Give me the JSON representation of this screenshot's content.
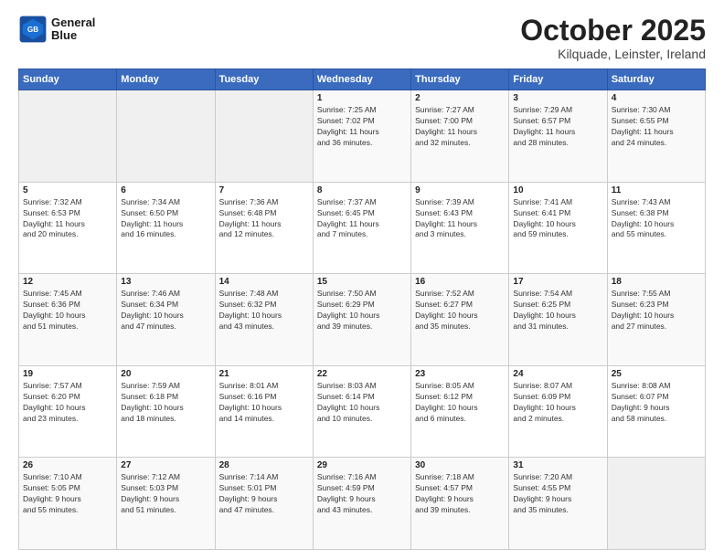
{
  "logo": {
    "line1": "General",
    "line2": "Blue"
  },
  "title": "October 2025",
  "subtitle": "Kilquade, Leinster, Ireland",
  "weekdays": [
    "Sunday",
    "Monday",
    "Tuesday",
    "Wednesday",
    "Thursday",
    "Friday",
    "Saturday"
  ],
  "weeks": [
    [
      {
        "day": "",
        "info": ""
      },
      {
        "day": "",
        "info": ""
      },
      {
        "day": "",
        "info": ""
      },
      {
        "day": "1",
        "info": "Sunrise: 7:25 AM\nSunset: 7:02 PM\nDaylight: 11 hours\nand 36 minutes."
      },
      {
        "day": "2",
        "info": "Sunrise: 7:27 AM\nSunset: 7:00 PM\nDaylight: 11 hours\nand 32 minutes."
      },
      {
        "day": "3",
        "info": "Sunrise: 7:29 AM\nSunset: 6:57 PM\nDaylight: 11 hours\nand 28 minutes."
      },
      {
        "day": "4",
        "info": "Sunrise: 7:30 AM\nSunset: 6:55 PM\nDaylight: 11 hours\nand 24 minutes."
      }
    ],
    [
      {
        "day": "5",
        "info": "Sunrise: 7:32 AM\nSunset: 6:53 PM\nDaylight: 11 hours\nand 20 minutes."
      },
      {
        "day": "6",
        "info": "Sunrise: 7:34 AM\nSunset: 6:50 PM\nDaylight: 11 hours\nand 16 minutes."
      },
      {
        "day": "7",
        "info": "Sunrise: 7:36 AM\nSunset: 6:48 PM\nDaylight: 11 hours\nand 12 minutes."
      },
      {
        "day": "8",
        "info": "Sunrise: 7:37 AM\nSunset: 6:45 PM\nDaylight: 11 hours\nand 7 minutes."
      },
      {
        "day": "9",
        "info": "Sunrise: 7:39 AM\nSunset: 6:43 PM\nDaylight: 11 hours\nand 3 minutes."
      },
      {
        "day": "10",
        "info": "Sunrise: 7:41 AM\nSunset: 6:41 PM\nDaylight: 10 hours\nand 59 minutes."
      },
      {
        "day": "11",
        "info": "Sunrise: 7:43 AM\nSunset: 6:38 PM\nDaylight: 10 hours\nand 55 minutes."
      }
    ],
    [
      {
        "day": "12",
        "info": "Sunrise: 7:45 AM\nSunset: 6:36 PM\nDaylight: 10 hours\nand 51 minutes."
      },
      {
        "day": "13",
        "info": "Sunrise: 7:46 AM\nSunset: 6:34 PM\nDaylight: 10 hours\nand 47 minutes."
      },
      {
        "day": "14",
        "info": "Sunrise: 7:48 AM\nSunset: 6:32 PM\nDaylight: 10 hours\nand 43 minutes."
      },
      {
        "day": "15",
        "info": "Sunrise: 7:50 AM\nSunset: 6:29 PM\nDaylight: 10 hours\nand 39 minutes."
      },
      {
        "day": "16",
        "info": "Sunrise: 7:52 AM\nSunset: 6:27 PM\nDaylight: 10 hours\nand 35 minutes."
      },
      {
        "day": "17",
        "info": "Sunrise: 7:54 AM\nSunset: 6:25 PM\nDaylight: 10 hours\nand 31 minutes."
      },
      {
        "day": "18",
        "info": "Sunrise: 7:55 AM\nSunset: 6:23 PM\nDaylight: 10 hours\nand 27 minutes."
      }
    ],
    [
      {
        "day": "19",
        "info": "Sunrise: 7:57 AM\nSunset: 6:20 PM\nDaylight: 10 hours\nand 23 minutes."
      },
      {
        "day": "20",
        "info": "Sunrise: 7:59 AM\nSunset: 6:18 PM\nDaylight: 10 hours\nand 18 minutes."
      },
      {
        "day": "21",
        "info": "Sunrise: 8:01 AM\nSunset: 6:16 PM\nDaylight: 10 hours\nand 14 minutes."
      },
      {
        "day": "22",
        "info": "Sunrise: 8:03 AM\nSunset: 6:14 PM\nDaylight: 10 hours\nand 10 minutes."
      },
      {
        "day": "23",
        "info": "Sunrise: 8:05 AM\nSunset: 6:12 PM\nDaylight: 10 hours\nand 6 minutes."
      },
      {
        "day": "24",
        "info": "Sunrise: 8:07 AM\nSunset: 6:09 PM\nDaylight: 10 hours\nand 2 minutes."
      },
      {
        "day": "25",
        "info": "Sunrise: 8:08 AM\nSunset: 6:07 PM\nDaylight: 9 hours\nand 58 minutes."
      }
    ],
    [
      {
        "day": "26",
        "info": "Sunrise: 7:10 AM\nSunset: 5:05 PM\nDaylight: 9 hours\nand 55 minutes."
      },
      {
        "day": "27",
        "info": "Sunrise: 7:12 AM\nSunset: 5:03 PM\nDaylight: 9 hours\nand 51 minutes."
      },
      {
        "day": "28",
        "info": "Sunrise: 7:14 AM\nSunset: 5:01 PM\nDaylight: 9 hours\nand 47 minutes."
      },
      {
        "day": "29",
        "info": "Sunrise: 7:16 AM\nSunset: 4:59 PM\nDaylight: 9 hours\nand 43 minutes."
      },
      {
        "day": "30",
        "info": "Sunrise: 7:18 AM\nSunset: 4:57 PM\nDaylight: 9 hours\nand 39 minutes."
      },
      {
        "day": "31",
        "info": "Sunrise: 7:20 AM\nSunset: 4:55 PM\nDaylight: 9 hours\nand 35 minutes."
      },
      {
        "day": "",
        "info": ""
      }
    ]
  ]
}
